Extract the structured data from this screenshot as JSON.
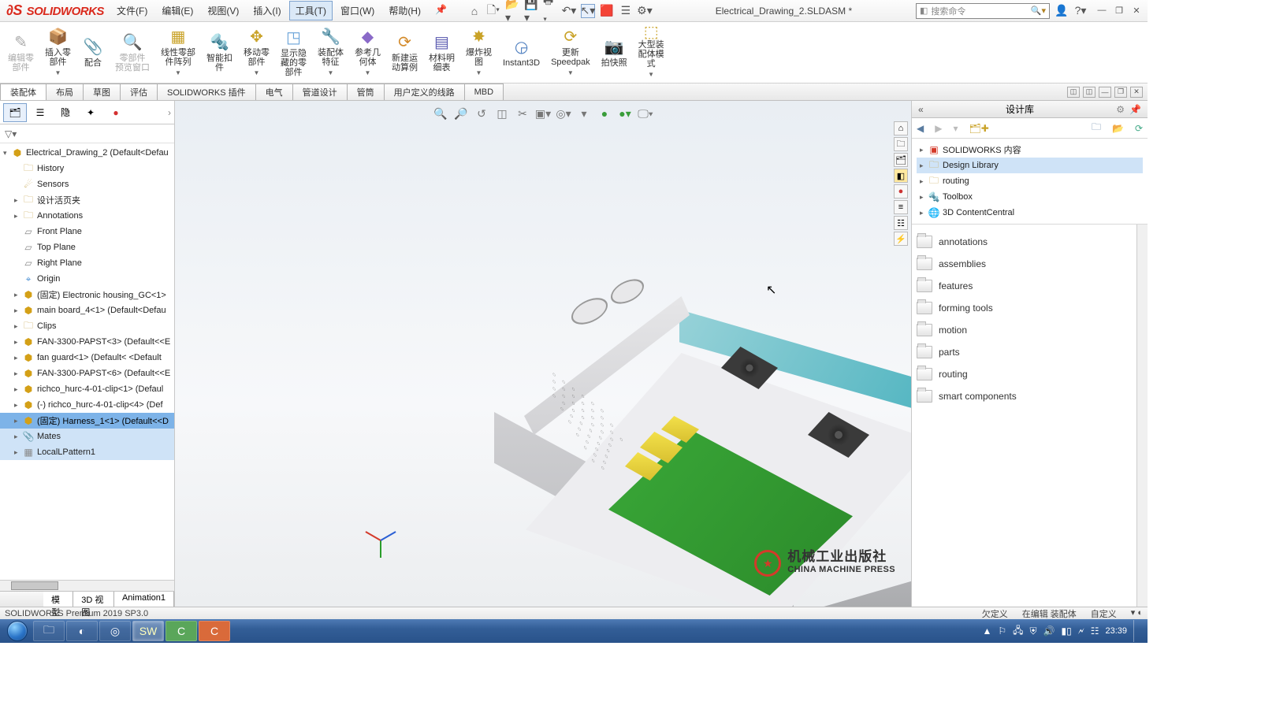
{
  "app": {
    "document_title": "Electrical_Drawing_2.SLDASM *",
    "search_placeholder": "搜索命令"
  },
  "menu": {
    "file": "文件(F)",
    "edit": "编辑(E)",
    "view": "视图(V)",
    "insert": "插入(I)",
    "tools": "工具(T)",
    "window": "窗口(W)",
    "help": "帮助(H)"
  },
  "ribbon": {
    "b1": "编辑零\n部件",
    "b2": "插入零\n部件",
    "b3": "配合",
    "b4": "零部件\n预览窗口",
    "b5": "线性零部\n件阵列",
    "b6": "智能扣\n件",
    "b7": "移动零\n部件",
    "b8": "显示隐\n藏的零\n部件",
    "b9": "装配体\n特征",
    "b10": "参考几\n何体",
    "b11": "新建运\n动算例",
    "b12": "材料明\n细表",
    "b13": "爆炸视\n图",
    "b14": "Instant3D",
    "b15": "更新\nSpeedpak",
    "b16": "拍快照",
    "b17": "大型装\n配体模\n式"
  },
  "cmd_tabs": {
    "t1": "装配体",
    "t2": "布局",
    "t3": "草图",
    "t4": "评估",
    "t5": "SOLIDWORKS 插件",
    "t6": "电气",
    "t7": "管道设计",
    "t8": "管筒",
    "t9": "用户定义的线路",
    "t10": "MBD"
  },
  "fm_bottom_tabs": {
    "model": "模型",
    "view3d": "3D 视图",
    "anim": "Animation1"
  },
  "tree": {
    "root": "Electrical_Drawing_2  (Default<Defau",
    "history": "History",
    "sensors": "Sensors",
    "designbinder": "设计活页夹",
    "annotations": "Annotations",
    "front": "Front Plane",
    "top": "Top Plane",
    "right": "Right Plane",
    "origin": "Origin",
    "p1": "(固定) Electronic housing_GC<1>",
    "p2": "main board_4<1> (Default<Defau",
    "p3": "Clips",
    "p4": "FAN-3300-PAPST<3> (Default<<E",
    "p5": "fan guard<1> (Default< <Default",
    "p6": "FAN-3300-PAPST<6> (Default<<E",
    "p7": "richco_hurc-4-01-clip<1> (Defaul",
    "p8": "(-) richco_hurc-4-01-clip<4> (Def",
    "p9": "(固定) Harness_1<1>  (Default<<D",
    "mates": "Mates",
    "pattern": "LocalLPattern1"
  },
  "dl": {
    "title": "设计库",
    "nodes": {
      "n1": "SOLIDWORKS 内容",
      "n2": "Design Library",
      "n3": "routing",
      "n4": "Toolbox",
      "n5": "3D ContentCentral"
    },
    "folders": {
      "f1": "annotations",
      "f2": "assemblies",
      "f3": "features",
      "f4": "forming tools",
      "f5": "motion",
      "f6": "parts",
      "f7": "routing",
      "f8": "smart components"
    }
  },
  "status": {
    "version": "SOLIDWORKS Premium 2019 SP3.0",
    "s1": "欠定义",
    "s2": "在编辑 装配体",
    "s3": "自定义"
  },
  "watermark": {
    "cn": "机械工业出版社",
    "en": "CHINA MACHINE PRESS",
    "star": "★"
  },
  "taskbar": {
    "time": "23:39",
    "date": ""
  }
}
